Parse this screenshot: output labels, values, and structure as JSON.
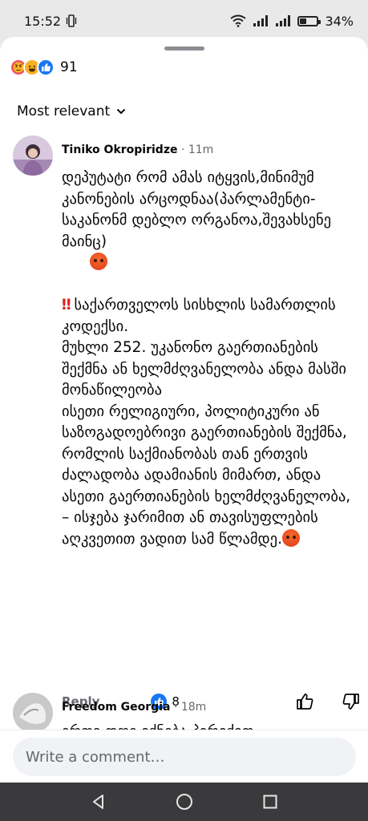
{
  "status": {
    "time": "15:52",
    "battery": "34%",
    "battery_level": 0.34
  },
  "reactions": {
    "types": [
      "angry",
      "haha",
      "like"
    ],
    "count": "91"
  },
  "sort": {
    "label": "Most relevant"
  },
  "comments": [
    {
      "author": "Tiniko Okropiridze",
      "time": "11m",
      "paragraphs": [
        "დეპუტატი რომ ამას იტყვის,მინიმუმ კანონების არცოდნაა(პარლამენტი-საკანონმ დებლო ორგანოა,შევახსენე მაინც)",
        "საქართველოს სისხლის სამართლის კოდექსი.\nმუხლი 252. უკანონო გაერთიანების შექმნა ან ხელმძღვანელობა ანდა მასში მონაწილეობა\nისეთი რელიგიური, პოლიტიკური ან საზოგადოებრივი გაერთიანების შექმნა, რომლის საქმიანობას თან ერთვის ძალადობა ადამიანის მიმართ, ანდა ასეთი გაერთიანების ხელმძღვანელობა, – ისჯება ჯარიმით ან თავისუფლების აღკვეთით ვადით სამ წლამდე."
      ],
      "reply_label": "Reply",
      "likes": "8"
    },
    {
      "author": "Freedom Georgia",
      "time": "18m",
      "preview": "ერთი დღე იქნება პირიქით"
    }
  ],
  "composer": {
    "placeholder": "Write a comment…"
  },
  "colors": {
    "accent": "#1877f2",
    "angry": "#e23b1a",
    "nav": "#3a3a3c"
  },
  "icons": [
    "vibrate-icon",
    "wifi-icon",
    "signal-icon",
    "battery-icon",
    "chevron-down-icon",
    "like-icon",
    "dislike-icon",
    "back-icon",
    "home-icon",
    "recents-icon"
  ]
}
